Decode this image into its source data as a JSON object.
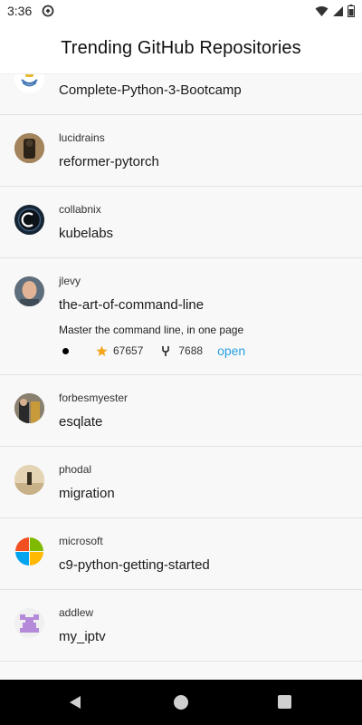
{
  "status_bar": {
    "time": "3:36",
    "icons": [
      "sync-icon",
      "wifi-icon",
      "signal-icon",
      "battery-icon"
    ]
  },
  "app_bar": {
    "title": "Trending GitHub Repositories"
  },
  "repos": [
    {
      "owner": "",
      "name": "Complete-Python-3-Bootcamp",
      "avatar": "python-logo-avatar"
    },
    {
      "owner": "lucidrains",
      "name": "reformer-pytorch",
      "avatar": "photo-avatar"
    },
    {
      "owner": "collabnix",
      "name": "kubelabs",
      "avatar": "collabnix-logo-avatar"
    },
    {
      "owner": "jlevy",
      "name": "the-art-of-command-line",
      "avatar": "photo-avatar",
      "description": "Master the command line, in one page",
      "language_color": "#000000",
      "stars": "67657",
      "forks": "7688",
      "open_label": "open"
    },
    {
      "owner": "forbesmyester",
      "name": "esqlate",
      "avatar": "photo-avatar"
    },
    {
      "owner": "phodal",
      "name": "migration",
      "avatar": "photo-avatar"
    },
    {
      "owner": "microsoft",
      "name": "c9-python-getting-started",
      "avatar": "microsoft-logo-avatar"
    },
    {
      "owner": "addlew",
      "name": "my_iptv",
      "avatar": "identicon-avatar"
    }
  ],
  "colors": {
    "accent_link": "#27a0e0",
    "star": "#f2a51a",
    "divider": "#e2e2e2"
  }
}
